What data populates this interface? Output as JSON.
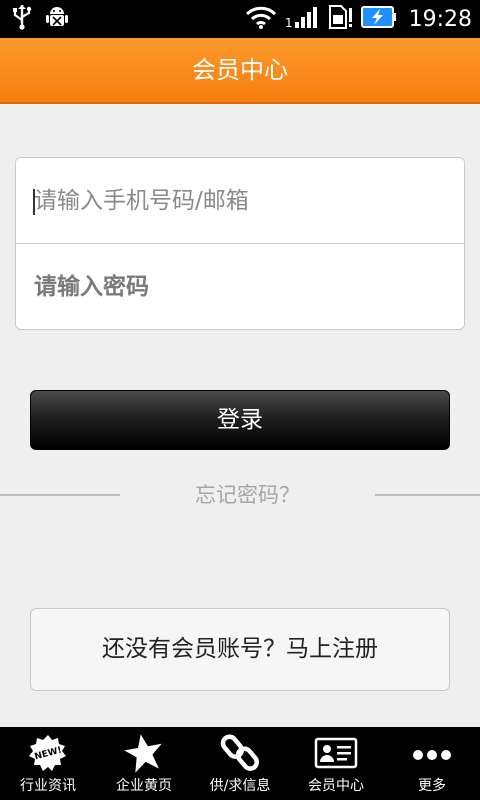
{
  "status_bar": {
    "time": "19:28",
    "icons": [
      "usb-icon",
      "android-debug-icon",
      "wifi-icon",
      "signal-icon",
      "sim-icon",
      "battery-charging-icon"
    ]
  },
  "header": {
    "title": "会员中心"
  },
  "login_form": {
    "phone_placeholder": "请输入手机号码/邮箱",
    "password_placeholder": "请输入密码",
    "login_label": "登录",
    "forgot_label": "忘记密码？"
  },
  "register": {
    "label": "还没有会员账号？马上注册"
  },
  "bottom_nav": {
    "items": [
      {
        "label": "行业资讯",
        "icon": "news-icon"
      },
      {
        "label": "企业黄页",
        "icon": "star-icon"
      },
      {
        "label": "供/求信息",
        "icon": "link-icon"
      },
      {
        "label": "会员中心",
        "icon": "member-card-icon"
      },
      {
        "label": "更多",
        "icon": "more-icon"
      }
    ]
  },
  "colors": {
    "accent": "#f78a1c",
    "status_bar": "#000000",
    "bottom_nav": "#000000"
  }
}
